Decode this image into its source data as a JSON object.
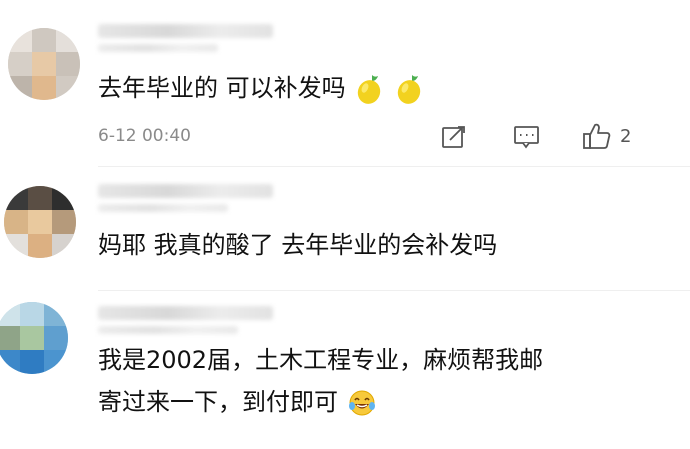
{
  "comments": [
    {
      "text": "去年毕业的 可以补发吗",
      "emojis": [
        "lemon-icon",
        "lemon-icon"
      ],
      "timestamp": "6-12 00:40",
      "like_count": "2"
    },
    {
      "text": "妈耶 我真的酸了 去年毕业的会补发吗"
    },
    {
      "text_line1": "我是2002届，土木工程专业，麻烦帮我邮",
      "text_line2": "寄过来一下，到付即可",
      "emojis": [
        "laughing-tears-icon"
      ]
    }
  ],
  "colors": {
    "text": "#111111",
    "meta": "#8a8a8a",
    "lemon": "#f2d21f",
    "leaf": "#4caf50"
  }
}
